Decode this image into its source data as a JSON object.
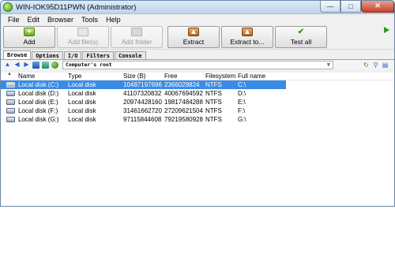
{
  "window": {
    "title": "WIN-IOK95D11PWN (Administrator)"
  },
  "menu": [
    "File",
    "Edit",
    "Browser",
    "Tools",
    "Help"
  ],
  "toolbar": {
    "add": "Add",
    "add_files": "Add file(s)",
    "add_folder": "Add folder",
    "extract": "Extract",
    "extract_to": "Extract to...",
    "test_all": "Test all"
  },
  "tabs": [
    "Browse",
    "Options",
    "I/O",
    "Filters",
    "Console"
  ],
  "nav": {
    "path": "Computer's root"
  },
  "columns": {
    "name": "Name",
    "type": "Type",
    "size": "Size (B)",
    "free": "Free",
    "filesystem": "Filesystem",
    "full_name": "Full name"
  },
  "rows": [
    {
      "name": "Local disk (C:)",
      "type": "Local disk",
      "size": "10487197696",
      "free": "2366029824",
      "fs": "NTFS",
      "full": "C:\\"
    },
    {
      "name": "Local disk (D:)",
      "type": "Local disk",
      "size": "41107320832",
      "free": "40067694592",
      "fs": "NTFS",
      "full": "D:\\"
    },
    {
      "name": "Local disk (E:)",
      "type": "Local disk",
      "size": "20974428160",
      "free": "19817484288",
      "fs": "NTFS",
      "full": "E:\\"
    },
    {
      "name": "Local disk (F:)",
      "type": "Local disk",
      "size": "31461662720",
      "free": "27209621504",
      "fs": "NTFS",
      "full": "F:\\"
    },
    {
      "name": "Local disk (G:)",
      "type": "Local disk",
      "size": "97115844608",
      "free": "79219580928",
      "fs": "NTFS",
      "full": "G:\\"
    }
  ],
  "selected_row": 0,
  "colors": {
    "selection": "#3a8be6",
    "accent_green": "#2e9a10"
  }
}
